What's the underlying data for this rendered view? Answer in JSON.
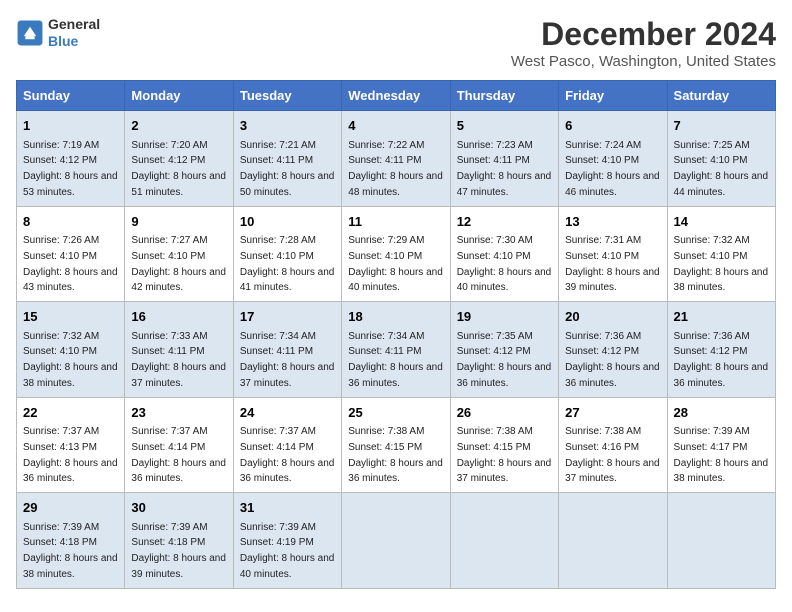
{
  "header": {
    "logo_line1": "General",
    "logo_line2": "Blue",
    "month_title": "December 2024",
    "location": "West Pasco, Washington, United States"
  },
  "days_of_week": [
    "Sunday",
    "Monday",
    "Tuesday",
    "Wednesday",
    "Thursday",
    "Friday",
    "Saturday"
  ],
  "weeks": [
    [
      {
        "day": "1",
        "sunrise": "Sunrise: 7:19 AM",
        "sunset": "Sunset: 4:12 PM",
        "daylight": "Daylight: 8 hours and 53 minutes."
      },
      {
        "day": "2",
        "sunrise": "Sunrise: 7:20 AM",
        "sunset": "Sunset: 4:12 PM",
        "daylight": "Daylight: 8 hours and 51 minutes."
      },
      {
        "day": "3",
        "sunrise": "Sunrise: 7:21 AM",
        "sunset": "Sunset: 4:11 PM",
        "daylight": "Daylight: 8 hours and 50 minutes."
      },
      {
        "day": "4",
        "sunrise": "Sunrise: 7:22 AM",
        "sunset": "Sunset: 4:11 PM",
        "daylight": "Daylight: 8 hours and 48 minutes."
      },
      {
        "day": "5",
        "sunrise": "Sunrise: 7:23 AM",
        "sunset": "Sunset: 4:11 PM",
        "daylight": "Daylight: 8 hours and 47 minutes."
      },
      {
        "day": "6",
        "sunrise": "Sunrise: 7:24 AM",
        "sunset": "Sunset: 4:10 PM",
        "daylight": "Daylight: 8 hours and 46 minutes."
      },
      {
        "day": "7",
        "sunrise": "Sunrise: 7:25 AM",
        "sunset": "Sunset: 4:10 PM",
        "daylight": "Daylight: 8 hours and 44 minutes."
      }
    ],
    [
      {
        "day": "8",
        "sunrise": "Sunrise: 7:26 AM",
        "sunset": "Sunset: 4:10 PM",
        "daylight": "Daylight: 8 hours and 43 minutes."
      },
      {
        "day": "9",
        "sunrise": "Sunrise: 7:27 AM",
        "sunset": "Sunset: 4:10 PM",
        "daylight": "Daylight: 8 hours and 42 minutes."
      },
      {
        "day": "10",
        "sunrise": "Sunrise: 7:28 AM",
        "sunset": "Sunset: 4:10 PM",
        "daylight": "Daylight: 8 hours and 41 minutes."
      },
      {
        "day": "11",
        "sunrise": "Sunrise: 7:29 AM",
        "sunset": "Sunset: 4:10 PM",
        "daylight": "Daylight: 8 hours and 40 minutes."
      },
      {
        "day": "12",
        "sunrise": "Sunrise: 7:30 AM",
        "sunset": "Sunset: 4:10 PM",
        "daylight": "Daylight: 8 hours and 40 minutes."
      },
      {
        "day": "13",
        "sunrise": "Sunrise: 7:31 AM",
        "sunset": "Sunset: 4:10 PM",
        "daylight": "Daylight: 8 hours and 39 minutes."
      },
      {
        "day": "14",
        "sunrise": "Sunrise: 7:32 AM",
        "sunset": "Sunset: 4:10 PM",
        "daylight": "Daylight: 8 hours and 38 minutes."
      }
    ],
    [
      {
        "day": "15",
        "sunrise": "Sunrise: 7:32 AM",
        "sunset": "Sunset: 4:10 PM",
        "daylight": "Daylight: 8 hours and 38 minutes."
      },
      {
        "day": "16",
        "sunrise": "Sunrise: 7:33 AM",
        "sunset": "Sunset: 4:11 PM",
        "daylight": "Daylight: 8 hours and 37 minutes."
      },
      {
        "day": "17",
        "sunrise": "Sunrise: 7:34 AM",
        "sunset": "Sunset: 4:11 PM",
        "daylight": "Daylight: 8 hours and 37 minutes."
      },
      {
        "day": "18",
        "sunrise": "Sunrise: 7:34 AM",
        "sunset": "Sunset: 4:11 PM",
        "daylight": "Daylight: 8 hours and 36 minutes."
      },
      {
        "day": "19",
        "sunrise": "Sunrise: 7:35 AM",
        "sunset": "Sunset: 4:12 PM",
        "daylight": "Daylight: 8 hours and 36 minutes."
      },
      {
        "day": "20",
        "sunrise": "Sunrise: 7:36 AM",
        "sunset": "Sunset: 4:12 PM",
        "daylight": "Daylight: 8 hours and 36 minutes."
      },
      {
        "day": "21",
        "sunrise": "Sunrise: 7:36 AM",
        "sunset": "Sunset: 4:12 PM",
        "daylight": "Daylight: 8 hours and 36 minutes."
      }
    ],
    [
      {
        "day": "22",
        "sunrise": "Sunrise: 7:37 AM",
        "sunset": "Sunset: 4:13 PM",
        "daylight": "Daylight: 8 hours and 36 minutes."
      },
      {
        "day": "23",
        "sunrise": "Sunrise: 7:37 AM",
        "sunset": "Sunset: 4:14 PM",
        "daylight": "Daylight: 8 hours and 36 minutes."
      },
      {
        "day": "24",
        "sunrise": "Sunrise: 7:37 AM",
        "sunset": "Sunset: 4:14 PM",
        "daylight": "Daylight: 8 hours and 36 minutes."
      },
      {
        "day": "25",
        "sunrise": "Sunrise: 7:38 AM",
        "sunset": "Sunset: 4:15 PM",
        "daylight": "Daylight: 8 hours and 36 minutes."
      },
      {
        "day": "26",
        "sunrise": "Sunrise: 7:38 AM",
        "sunset": "Sunset: 4:15 PM",
        "daylight": "Daylight: 8 hours and 37 minutes."
      },
      {
        "day": "27",
        "sunrise": "Sunrise: 7:38 AM",
        "sunset": "Sunset: 4:16 PM",
        "daylight": "Daylight: 8 hours and 37 minutes."
      },
      {
        "day": "28",
        "sunrise": "Sunrise: 7:39 AM",
        "sunset": "Sunset: 4:17 PM",
        "daylight": "Daylight: 8 hours and 38 minutes."
      }
    ],
    [
      {
        "day": "29",
        "sunrise": "Sunrise: 7:39 AM",
        "sunset": "Sunset: 4:18 PM",
        "daylight": "Daylight: 8 hours and 38 minutes."
      },
      {
        "day": "30",
        "sunrise": "Sunrise: 7:39 AM",
        "sunset": "Sunset: 4:18 PM",
        "daylight": "Daylight: 8 hours and 39 minutes."
      },
      {
        "day": "31",
        "sunrise": "Sunrise: 7:39 AM",
        "sunset": "Sunset: 4:19 PM",
        "daylight": "Daylight: 8 hours and 40 minutes."
      },
      null,
      null,
      null,
      null
    ]
  ]
}
